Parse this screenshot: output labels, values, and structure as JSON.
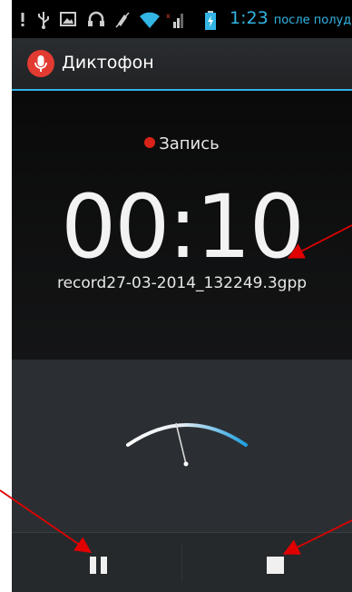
{
  "status_bar": {
    "time": "1:23",
    "time_suffix": "после полудня",
    "icons": [
      "usb-icon",
      "image-icon",
      "headset-icon",
      "mute-icon",
      "wifi-icon",
      "signal-icon",
      "battery-icon"
    ],
    "accent_color": "#33b5e5"
  },
  "action_bar": {
    "title": "Диктофон",
    "icon": "microphone-icon",
    "icon_color": "#e23b32"
  },
  "recorder": {
    "status_label": "Запись",
    "status_color": "#d8231a",
    "timer": "00:10",
    "filename": "record27-03-2014_132249.3gpp"
  },
  "level_meter": {
    "needle_level": 0.55
  },
  "controls": {
    "pause_icon": "pause-icon",
    "stop_icon": "stop-icon"
  },
  "annotations": {
    "arrow_color": "#e00000"
  }
}
